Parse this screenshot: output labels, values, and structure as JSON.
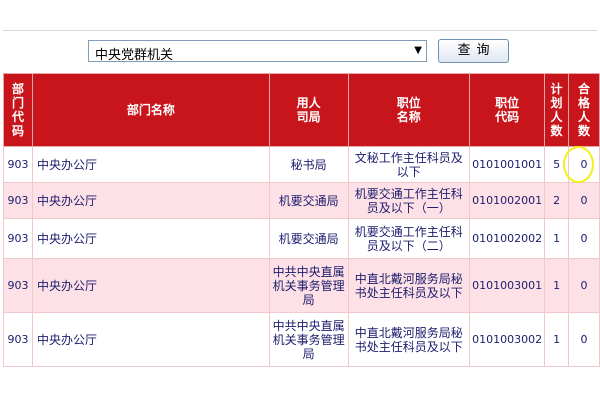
{
  "search": {
    "select_value": "中央党群机关",
    "button_label": "查询"
  },
  "table": {
    "headers": {
      "dept_code": "部门代码",
      "dept_name": "部门名称",
      "employer": "用人司局",
      "position_name": "职位名称",
      "position_code": "职位代码",
      "planned": "计划人数",
      "qualified": "合格人数"
    },
    "rows": [
      {
        "dept_code": "903",
        "dept_name": "中央办公厅",
        "employer": "秘书局",
        "position_name": "文秘工作主任科员及以下",
        "position_code": "0101001001",
        "planned": "5",
        "qualified": "0"
      },
      {
        "dept_code": "903",
        "dept_name": "中央办公厅",
        "employer": "机要交通局",
        "position_name": "机要交通工作主任科员及以下（一）",
        "position_code": "0101002001",
        "planned": "2",
        "qualified": "0"
      },
      {
        "dept_code": "903",
        "dept_name": "中央办公厅",
        "employer": "机要交通局",
        "position_name": "机要交通工作主任科员及以下（二）",
        "position_code": "0101002002",
        "planned": "1",
        "qualified": "0"
      },
      {
        "dept_code": "903",
        "dept_name": "中央办公厅",
        "employer": "中共中央直属机关事务管理局",
        "position_name": "中直北戴河服务局秘书处主任科员及以下",
        "position_code": "0101003001",
        "planned": "1",
        "qualified": "0"
      },
      {
        "dept_code": "903",
        "dept_name": "中央办公厅",
        "employer": "中共中央直属机关事务管理局",
        "position_name": "中直北戴河服务局秘书处主任科员及以下",
        "position_code": "0101003002",
        "planned": "1",
        "qualified": "0"
      }
    ]
  },
  "colors": {
    "header_bg": "#c8141b",
    "row_pink": "#fde1e6",
    "highlight_circle": "#f5ef1c"
  }
}
